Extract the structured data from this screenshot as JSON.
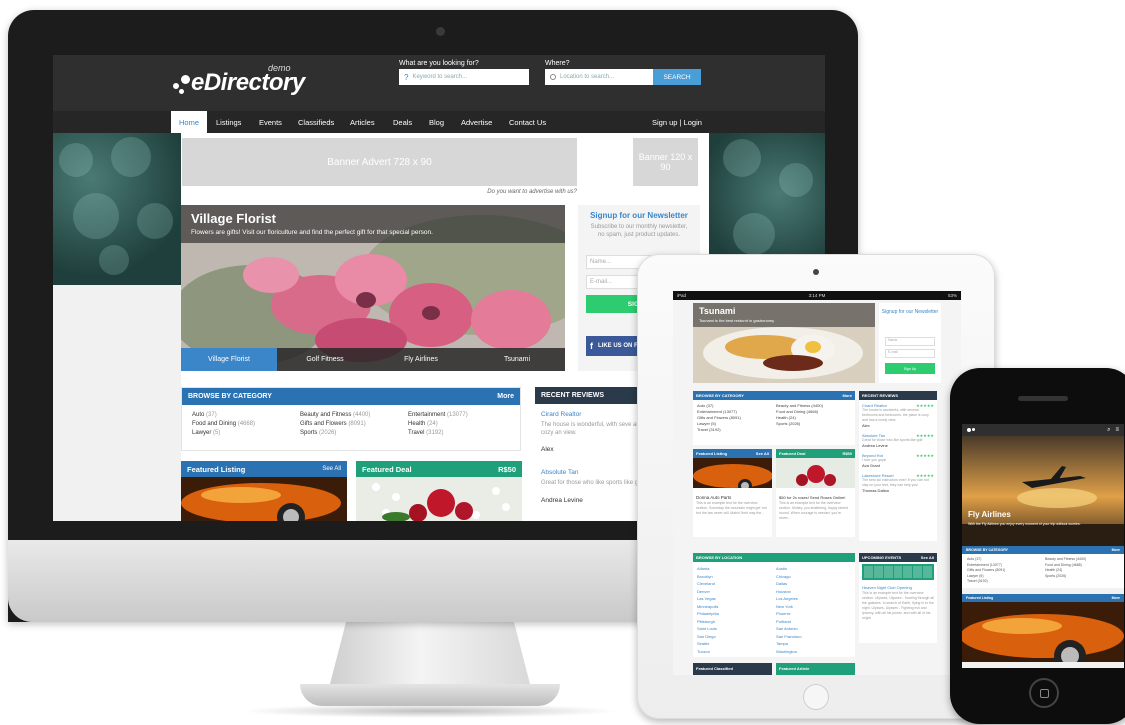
{
  "site": {
    "logo": "eDirectory",
    "logo_suffix": "demo",
    "search": {
      "what_label": "What are you looking for?",
      "what_placeholder": "Keyword to search...",
      "where_label": "Where?",
      "where_placeholder": "Location to search...",
      "button": "SEARCH"
    },
    "nav": {
      "items": [
        "Home",
        "Listings",
        "Events",
        "Classifieds",
        "Articles",
        "Deals",
        "Blog",
        "Advertise",
        "Contact Us"
      ],
      "account": "Sign up | Login"
    },
    "banners": {
      "leaderboard": "Banner Advert 728 x 90",
      "small": "Banner 120 x 90",
      "advertise": "Do you want to advertise with us?"
    },
    "slider": {
      "title": "Village Florist",
      "subtitle": "Flowers are gifts! Visit our floriculture and find the perfect gift for that special person.",
      "tabs": [
        "Village Florist",
        "Golf Fitness",
        "Fly Airlines",
        "Tsunami"
      ]
    },
    "newsletter": {
      "title": "Signup for our Newsletter",
      "text": "Subscribe to our monthly newsletter, no spam, just product updates.",
      "name_placeholder": "Name...",
      "email_placeholder": "E-mail...",
      "button": "SIGN U",
      "facebook": "LIKE US ON F"
    },
    "categories": {
      "title": "BROWSE BY CATEGORY",
      "more": "More",
      "items": [
        {
          "name": "Auto",
          "count": "(37)"
        },
        {
          "name": "Beauty and Fitness",
          "count": "(4400)"
        },
        {
          "name": "Entertainment",
          "count": "(13077)"
        },
        {
          "name": "Food and Dining",
          "count": "(4668)"
        },
        {
          "name": "Gifts and Flowers",
          "count": "(8091)"
        },
        {
          "name": "Health",
          "count": "(24)"
        },
        {
          "name": "Lawyer",
          "count": "(5)"
        },
        {
          "name": "Sports",
          "count": "(2026)"
        },
        {
          "name": "Travel",
          "count": "(3192)"
        }
      ]
    },
    "reviews": {
      "title": "RECENT REVIEWS",
      "items": [
        {
          "title": "Cirard Realtor",
          "body": "The house is wonderful, with seve and bedrooms, the place is cozy an view.",
          "author": "Alex"
        },
        {
          "title": "Absolute Tan",
          "body": "Great for those who like sports like golf.",
          "author": "Andrea Levine"
        }
      ]
    },
    "featured_listing": {
      "title": "Featured Listing",
      "link": "See All"
    },
    "featured_deal": {
      "title": "Featured Deal",
      "price": "R$50"
    }
  },
  "tablet": {
    "status_left": "iPad",
    "status_time": "3:14 PM",
    "status_right": "53%",
    "slide_title": "Tsunami",
    "slide_subtitle": "Tsunami is the best resturnt in gastronomy",
    "newsletter_title": "Signup for our Newsletter",
    "newsletter_name": "Name",
    "newsletter_email": "E-mail",
    "newsletter_button": "Sign Up",
    "category_title": "BROWSE BY CATEGORY",
    "category_more": "More",
    "categories": [
      "Auto (37)",
      "Beauty and Fitness (4400)",
      "Entertainment (13077)",
      "Food and Dining (4668)",
      "Gifts and Flowers (8091)",
      "Health (24)",
      "Lawyer (5)",
      "Sports (2026)",
      "Travel (3192)"
    ],
    "reviews_title": "RECENT REVIEWS",
    "reviews": [
      {
        "title": "Cirard Realtor",
        "body": "The house is wonderful, with several bedrooms and bedrooms, the place is cozy and has a lovely view.",
        "author": "Alex"
      },
      {
        "title": "Absolute Tan",
        "body": "Great for those who like sports like golf.",
        "author": "Andrea Levine"
      },
      {
        "title": "Beyond Hot",
        "body": "I love you guys!",
        "author": "Ava Grant"
      },
      {
        "title": "Lakeshore Resort",
        "body": "The best ski instructors ever! If you can not stay on your feet, they can help you!",
        "author": "Thomas Dalton"
      }
    ],
    "featured_listing": "Featured Listing",
    "featured_deal": "Featured Deal",
    "deal_price": "R$50",
    "see_all": "See All",
    "listing_name": "Donna Auto Parts",
    "listing_text": "This is an example text for the overview section. Someday the mountain might get 'em but the law never will. Makin' their way the...",
    "deal_name": "$50 for 2x roses! Send Roses Online!",
    "deal_text": "This is an example text for the overview section. Motley, you shattering, floppy tamed hound. When courage is needed, you're never...",
    "location_title": "BROWSE BY LOCATION",
    "locations": [
      "Atlanta",
      "Austin",
      "Brooklyn",
      "Chicago",
      "Cleveland",
      "Dallas",
      "Denver",
      "Houston",
      "Las Vegas",
      "Los Angeles",
      "Minneapolis",
      "New York",
      "Philadelphia",
      "Phoenix",
      "Pittsburgh",
      "Portland",
      "Saint Louis",
      "San Antonio",
      "San Diego",
      "San Francisco",
      "Seattle",
      "Tampa",
      "Tucson",
      "Washington"
    ],
    "events_title": "UPCOMING EVENTS",
    "event_name": "Heaven Night Club Opening",
    "event_text": "This is an example text for the overview section. Ulysses, Ulysses - Soaring through all the galaxies. In search of Earth, flying in to the night. Ulysses, Ulysses - Fighting evil and tyranny, with all his power, and with all of his might.",
    "featured_classified": "Featured Classified",
    "featured_article": "Featured Article"
  },
  "phone": {
    "slide_title": "Fly Airlines",
    "slide_subtitle": "With the Fly Airlines you enjoy every moment of your trip without worries.",
    "category_title": "BROWSE BY CATEGORY",
    "category_more": "More",
    "categories": [
      "Auto (37)",
      "Beauty and Fitness (4400)",
      "Entertainment (13077)",
      "Food and Dining (4668)",
      "Gifts and Flowers (8091)",
      "Health (24)",
      "Lawyer (5)",
      "Sports (2026)",
      "Travel (3192)"
    ],
    "featured_listing": "Featured Listing",
    "more": "More"
  },
  "colors": {
    "nav_blue": "#3a86c8",
    "category_blue": "#2b72b2",
    "deal_green": "#1f9f7a",
    "signup_green": "#2ecc71",
    "facebook": "#3b5998",
    "header_dark": "#2f2f2f"
  }
}
